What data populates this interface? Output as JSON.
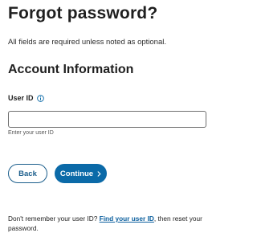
{
  "page": {
    "title": "Forgot password?",
    "note": "All fields are required unless noted as optional."
  },
  "section": {
    "heading": "Account Information"
  },
  "user_id_field": {
    "label": "User ID",
    "value": "",
    "placeholder": "",
    "helper": "Enter your user ID",
    "icon": "info-icon"
  },
  "actions": {
    "back_label": "Back",
    "continue_label": "Continue",
    "continue_icon": "chevron-right-icon"
  },
  "footer": {
    "prefix": "Don't remember your user ID? ",
    "link_label": "Find your user ID",
    "suffix": ", then reset your password."
  },
  "colors": {
    "primary": "#0b6aa8",
    "link": "#0b5f9e",
    "text": "#1f1f1f"
  }
}
